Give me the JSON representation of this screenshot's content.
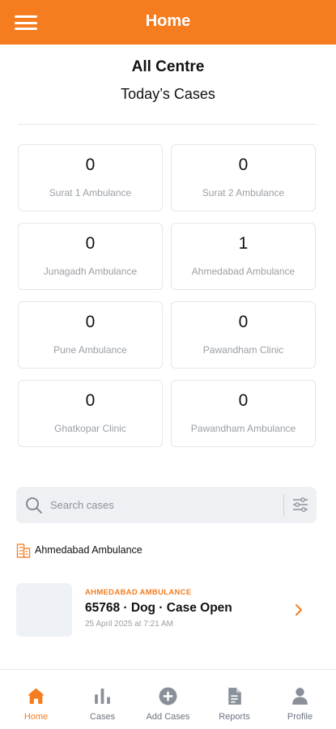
{
  "header": {
    "title": "Home",
    "menu_icon": "hamburger-menu-icon"
  },
  "summary": {
    "title": "All Centre",
    "subtitle": "Today’s Cases"
  },
  "centres": [
    {
      "count": "0",
      "name": "Surat 1 Ambulance"
    },
    {
      "count": "0",
      "name": "Surat 2 Ambulance"
    },
    {
      "count": "0",
      "name": "Junagadh Ambulance"
    },
    {
      "count": "1",
      "name": "Ahmedabad Ambulance"
    },
    {
      "count": "0",
      "name": "Pune Ambulance"
    },
    {
      "count": "0",
      "name": "Pawandham Clinic"
    },
    {
      "count": "0",
      "name": "Ghatkopar Clinic"
    },
    {
      "count": "0",
      "name": "Pawandham Ambulance"
    }
  ],
  "search": {
    "placeholder": "Search cases",
    "value": ""
  },
  "location": {
    "label": "Ahmedabad Ambulance",
    "icon": "building-icon"
  },
  "case": {
    "centre": "AHMEDABAD AMBULANCE",
    "title": "65768 · Dog · Case Open",
    "date": "25 April 2025 at 7:21 AM"
  },
  "nav": [
    {
      "label": "Home",
      "icon": "home-icon",
      "active": true
    },
    {
      "label": "Cases",
      "icon": "bar-chart-icon",
      "active": false
    },
    {
      "label": "Add Cases",
      "icon": "add-circle-icon",
      "active": false
    },
    {
      "label": "Reports",
      "icon": "report-icon",
      "active": false
    },
    {
      "label": "Profile",
      "icon": "profile-icon",
      "active": false
    }
  ],
  "colors": {
    "accent": "#f57c1f",
    "muted_text": "#9aa0a6",
    "card_border": "#e3e6ea",
    "nav_inactive": "#6b7280"
  }
}
